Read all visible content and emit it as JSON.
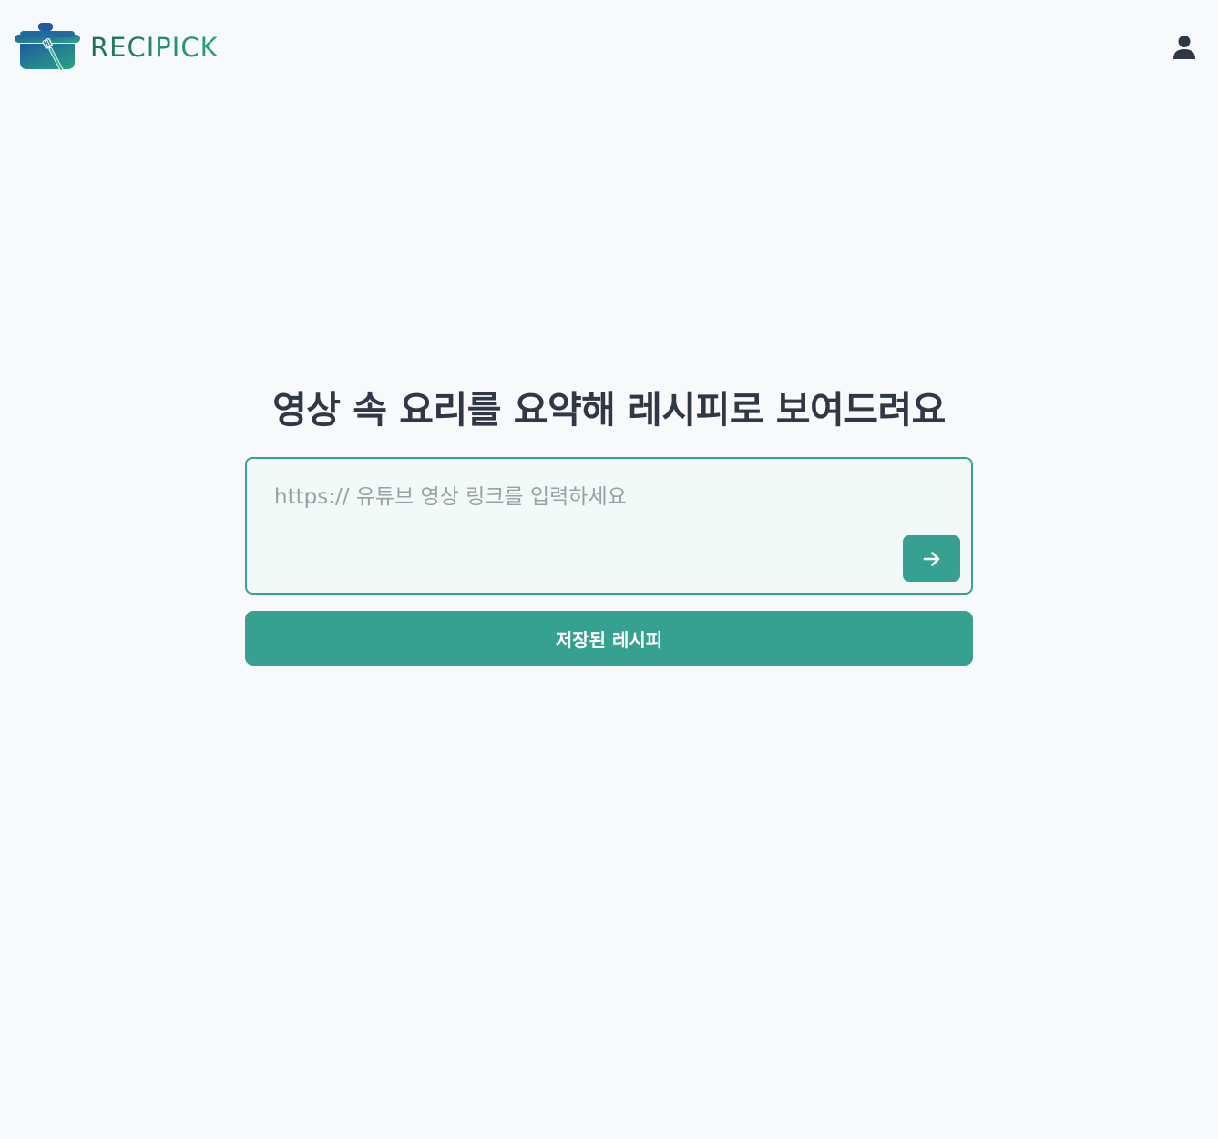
{
  "header": {
    "brand_name": "RECIPICK",
    "logo_icon": "cooking-pot-with-spatula-icon",
    "profile_icon": "user-icon"
  },
  "main": {
    "headline": "영상 속 요리를 요약해 레시피로 보여드려요",
    "link_input": {
      "value": "",
      "placeholder": "https:// 유튜브 영상 링크를 입력하세요"
    },
    "submit_icon": "arrow-right-icon",
    "saved_recipes_label": "저장된 레시피"
  },
  "colors": {
    "accent": "#36a091",
    "background": "#f8f9fb",
    "heading": "#313845",
    "brand_gradient_start": "#1e5f9e",
    "brand_gradient_end": "#2aa581"
  }
}
